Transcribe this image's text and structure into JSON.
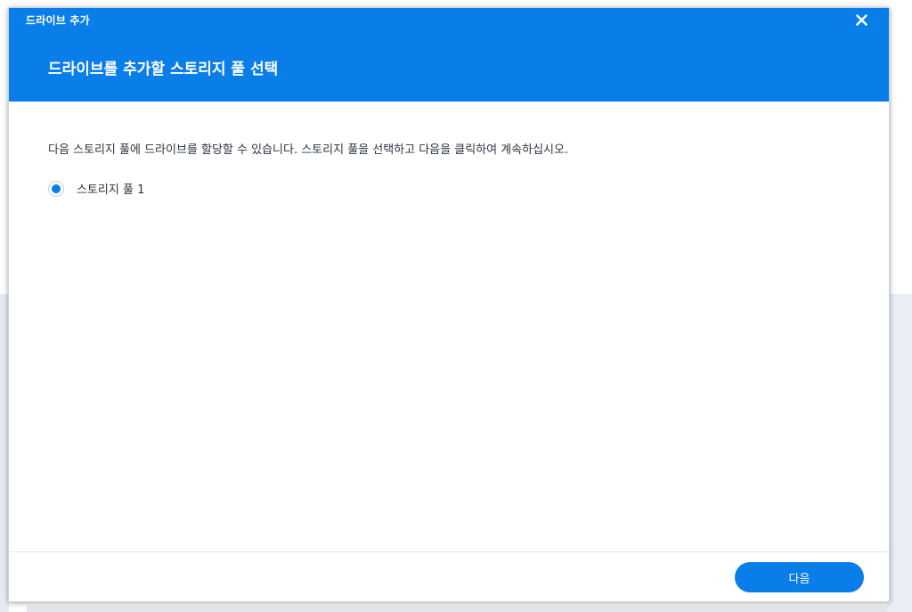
{
  "dialog": {
    "window_title": "드라이브 추가",
    "heading": "드라이브를 추가할 스토리지 풀 선택",
    "description": "다음 스토리지 풀에 드라이브를 할당할 수 있습니다. 스토리지 풀을 선택하고 다음을 클릭하여 계속하십시오.",
    "options": [
      {
        "label": "스토리지 풀 1",
        "selected": true
      }
    ],
    "next_label": "다음",
    "close_icon": "close-icon"
  },
  "colors": {
    "accent": "#0a7ee8",
    "header_text": "#ffffff",
    "body_text": "#2b3440"
  }
}
